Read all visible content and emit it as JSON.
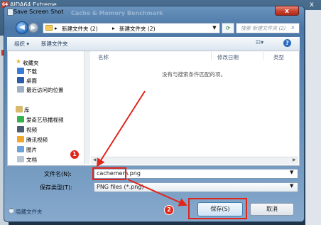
{
  "background_app": {
    "title": "AIDA64 Extreme",
    "icon_text": "64",
    "close_glyph": "x"
  },
  "dialog": {
    "title": "Save Screen Shot",
    "ghost_title": "Cache & Memory Benchmark",
    "close_glyph": "x"
  },
  "address_bar": {
    "crumbs": [
      "新建文件夹 (2)",
      "新建文件夹 (2)"
    ],
    "separator": "▸",
    "search_placeholder": "搜索 新建文件夹 (2)"
  },
  "toolbar": {
    "organize": "组织 ▾",
    "new_folder": "新建文件夹"
  },
  "nav_pane": {
    "favorites": {
      "header": "收藏夹",
      "items": [
        "下载",
        "桌面",
        "最近访问的位置"
      ]
    },
    "libraries": {
      "header": "库",
      "items": [
        "爱奇艺热播视频",
        "视频",
        "腾讯视频",
        "图片",
        "文档"
      ]
    }
  },
  "file_list": {
    "columns": [
      "名称",
      "修改日期",
      "类型"
    ],
    "empty_message": "没有与搜索条件匹配的项。"
  },
  "form": {
    "filename_label": "文件名(N):",
    "filename_value": "cachemem.png",
    "filetype_label": "保存类型(T):",
    "filetype_value": "PNG files (*.png)"
  },
  "footer": {
    "hide_folders": "隐藏文件夹",
    "save": "保存(S)",
    "cancel": "取消"
  },
  "annotations": {
    "step1": "1",
    "step2": "2",
    "color": "#e0251b"
  }
}
